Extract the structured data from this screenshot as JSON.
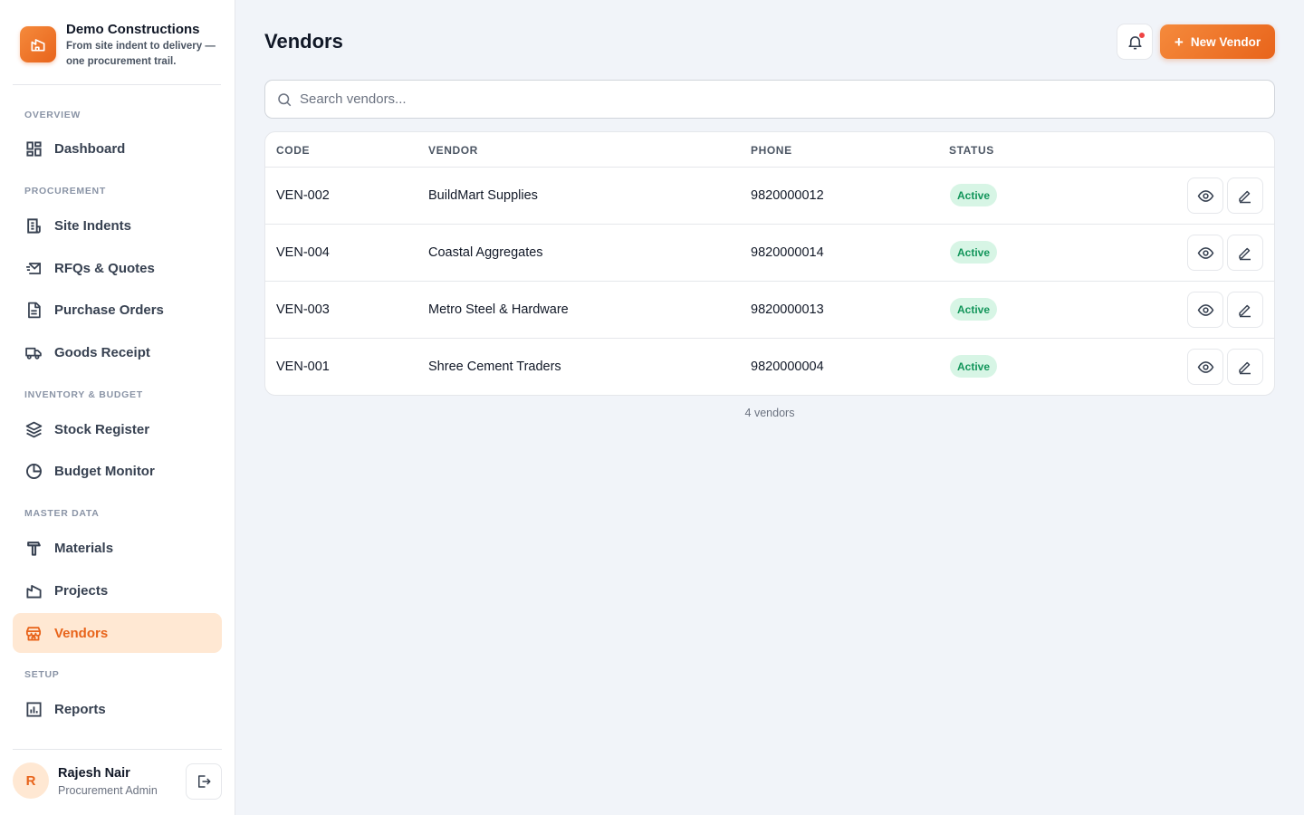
{
  "brand": {
    "name": "Demo Constructions",
    "tagline": "From site indent to delivery — one procurement trail."
  },
  "sidebar": {
    "sections": {
      "overview": "OVERVIEW",
      "procurement": "PROCUREMENT",
      "inventory": "INVENTORY & BUDGET",
      "master": "MASTER DATA",
      "setup": "SETUP"
    },
    "items": {
      "dashboard": "Dashboard",
      "site_indents": "Site Indents",
      "rfqs": "RFQs & Quotes",
      "purchase_orders": "Purchase Orders",
      "goods_receipt": "Goods Receipt",
      "stock_register": "Stock Register",
      "budget_monitor": "Budget Monitor",
      "materials": "Materials",
      "projects": "Projects",
      "vendors": "Vendors",
      "reports": "Reports"
    },
    "active": "vendors"
  },
  "user": {
    "initial": "R",
    "name": "Rajesh Nair",
    "role": "Procurement Admin"
  },
  "header": {
    "title": "Vendors",
    "new_button": "New Vendor",
    "new_button_icon": "+"
  },
  "search": {
    "placeholder": "Search vendors...",
    "value": ""
  },
  "table": {
    "columns": {
      "code": "CODE",
      "vendor": "VENDOR",
      "phone": "PHONE",
      "status": "STATUS"
    },
    "rows": [
      {
        "code": "VEN-002",
        "vendor": "BuildMart Supplies",
        "phone": "9820000012",
        "status": "Active"
      },
      {
        "code": "VEN-004",
        "vendor": "Coastal Aggregates",
        "phone": "9820000014",
        "status": "Active"
      },
      {
        "code": "VEN-003",
        "vendor": "Metro Steel & Hardware",
        "phone": "9820000013",
        "status": "Active"
      },
      {
        "code": "VEN-001",
        "vendor": "Shree Cement Traders",
        "phone": "9820000004",
        "status": "Active"
      }
    ]
  },
  "footer": {
    "count": "4 vendors"
  },
  "colors": {
    "accent": "#e8641b",
    "accent_light": "#ffe8d3",
    "status_active_bg": "#d7f5e5",
    "status_active_text": "#12955a",
    "notification_dot": "#ef4444"
  },
  "icons": {
    "brand": "building-icon",
    "dashboard": "dashboard-grid-icon",
    "site_indents": "document-list-icon",
    "rfqs": "mail-send-icon",
    "purchase_orders": "document-icon",
    "goods_receipt": "truck-icon",
    "stock_register": "layers-icon",
    "budget_monitor": "pie-chart-icon",
    "materials": "hammer-icon",
    "projects": "building-icon",
    "vendors": "store-icon",
    "reports": "bar-chart-icon",
    "logout": "logout-icon",
    "bell": "bell-icon",
    "search": "search-icon",
    "view": "eye-icon",
    "edit": "pencil-icon"
  }
}
